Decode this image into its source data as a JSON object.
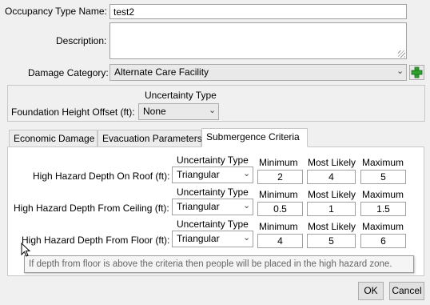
{
  "form": {
    "occupancy_type_label": "Occupancy Type Name:",
    "occupancy_type_value": "test2",
    "description_label": "Description:",
    "description_value": "",
    "damage_category_label": "Damage Category:",
    "damage_category_value": "Alternate Care Facility",
    "add_icon": "plus-icon"
  },
  "foundation": {
    "uncertainty_header": "Uncertainty Type",
    "label": "Foundation Height Offset (ft):",
    "value": "None"
  },
  "tabs": [
    {
      "label": "Economic Damage",
      "active": false
    },
    {
      "label": "Evacuation Parameters",
      "active": false
    },
    {
      "label": "Submergence Criteria",
      "active": true
    }
  ],
  "criteria": {
    "uncertainty_header": "Uncertainty Type",
    "min_header": "Minimum",
    "likely_header": "Most Likely",
    "max_header": "Maximum",
    "rows": [
      {
        "label": "High Hazard Depth On Roof (ft):",
        "type": "Triangular",
        "min": "2",
        "likely": "4",
        "max": "5"
      },
      {
        "label": "High Hazard Depth From Ceiling (ft):",
        "type": "Triangular",
        "min": "0.5",
        "likely": "1",
        "max": "1.5"
      },
      {
        "label": "High Hazard Depth From Floor (ft):",
        "type": "Triangular",
        "min": "4",
        "likely": "5",
        "max": "6"
      }
    ],
    "tooltip": "If depth from floor is above the criteria then people will be placed in the high hazard zone."
  },
  "buttons": {
    "ok": "OK",
    "cancel": "Cancel"
  }
}
